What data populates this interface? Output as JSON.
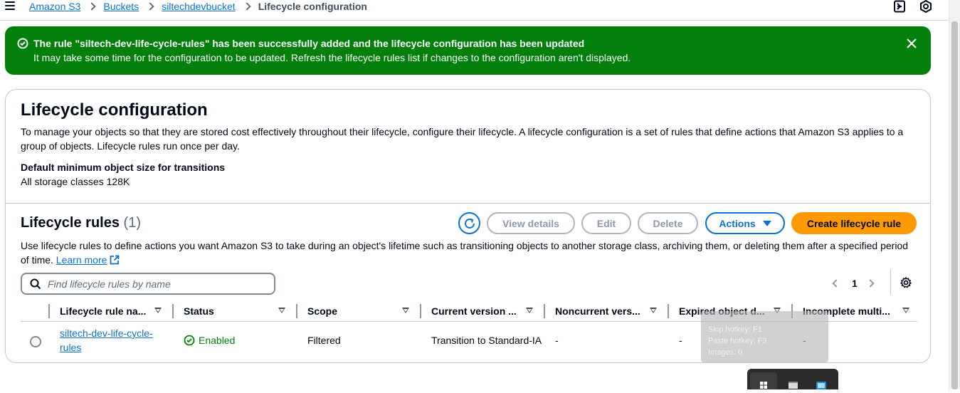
{
  "breadcrumbs": {
    "items": [
      "Amazon S3",
      "Buckets",
      "siltechdevbucket"
    ],
    "current": "Lifecycle configuration"
  },
  "flash": {
    "title": "The rule \"siltech-dev-life-cycle-rules\" has been successfully added and the lifecycle configuration has been updated",
    "body": "It may take some time for the configuration to be updated. Refresh the lifecycle rules list if changes to the configuration aren't displayed.",
    "color": "#037f0c"
  },
  "config": {
    "title": "Lifecycle configuration",
    "description": "To manage your objects so that they are stored cost effectively throughout their lifecycle, configure their lifecycle. A lifecycle configuration is a set of rules that define actions that Amazon S3 applies to a group of objects. Lifecycle rules run once per day.",
    "min_size_label": "Default minimum object size for transitions",
    "min_size_value": "All storage classes 128K"
  },
  "rules": {
    "title": "Lifecycle rules",
    "count": "(1)",
    "description": "Use lifecycle rules to define actions you want Amazon S3 to take during an object's lifetime such as transitioning objects to another storage class, archiving them, or deleting them after a specified period of time.",
    "learn_more": "Learn more",
    "buttons": {
      "view_details": "View details",
      "edit": "Edit",
      "delete": "Delete",
      "actions": "Actions",
      "create": "Create lifecycle rule"
    },
    "search_placeholder": "Find lifecycle rules by name",
    "page": "1",
    "columns": [
      "Lifecycle rule na...",
      "Status",
      "Scope",
      "Current version ...",
      "Noncurrent vers...",
      "Expired object d...",
      "Incomplete multi..."
    ],
    "rows": [
      {
        "name": "siltech-dev-life-cycle-rules",
        "status": "Enabled",
        "scope": "Filtered",
        "current_version": "Transition to Standard-IA",
        "noncurrent": "-",
        "expired": "-",
        "incomplete": "-"
      }
    ]
  },
  "overlay": {
    "lines": [
      "Skip hotkey: F1",
      "Paste hotkey: F3",
      "Images: 0"
    ]
  },
  "colors": {
    "link": "#0972d3",
    "primary_button": "#ff9900",
    "success": "#037f0c"
  }
}
